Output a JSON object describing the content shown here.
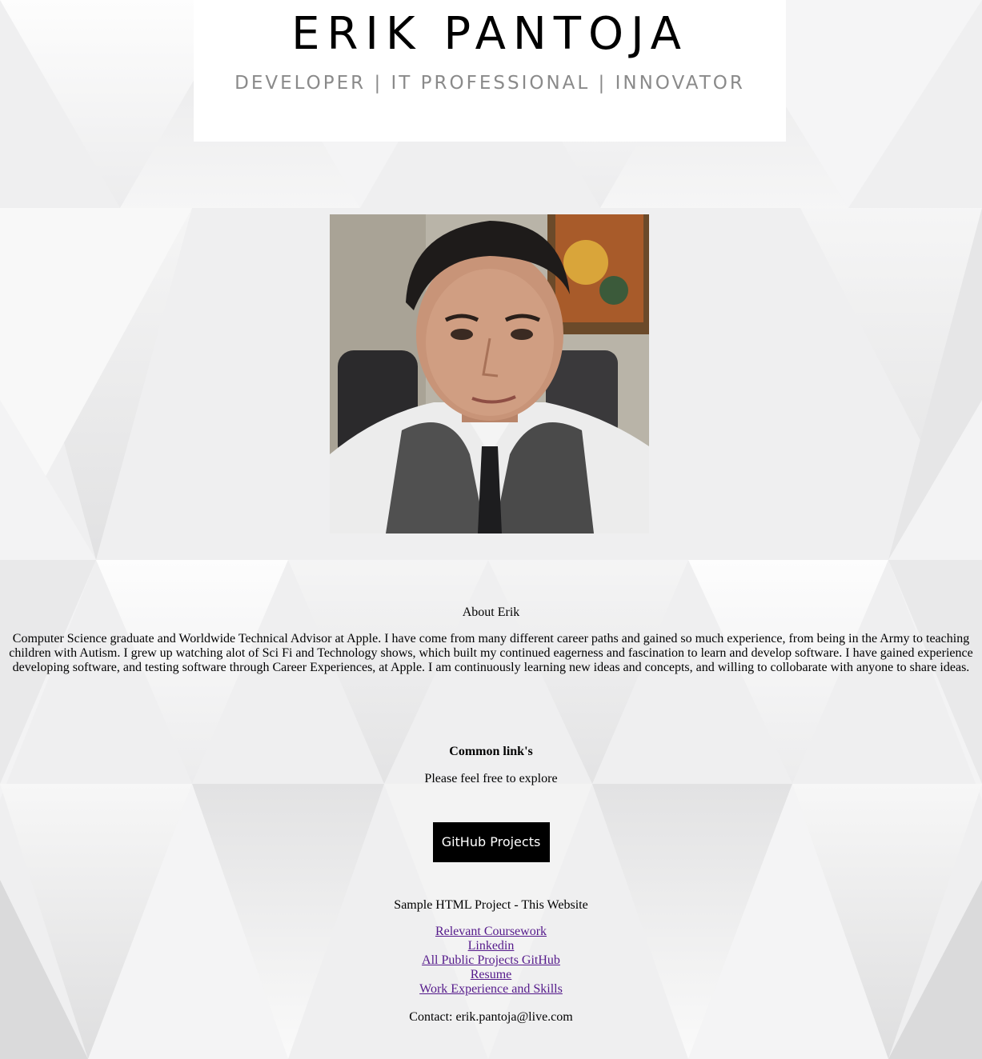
{
  "header": {
    "name": "ERIK PANTOJA",
    "tagline": "DEVELOPER | IT PROFESSIONAL | INNOVATOR"
  },
  "profile_photo": {
    "alt": "Erik Pantoja"
  },
  "about": {
    "title": "About Erik",
    "text": "Computer Science graduate and Worldwide Technical Advisor at Apple. I have come from many different career paths and gained so much experience, from being in the Army to teaching children with Autism. I grew up watching alot of Sci Fi and Technology shows, which built my continued eagerness and fascination to learn and develop software. I have gained experience developing software, and testing software through Career Experiences, at Apple. I am continuously learning new ideas and concepts, and willing to collobarate with anyone to share ideas."
  },
  "links_section": {
    "title": "Common link's",
    "subtitle": "Please feel free to explore",
    "github_button": "GitHub Projects",
    "sample_text": "Sample HTML Project - This Website",
    "links": [
      "Relevant Coursework",
      "Linkedin",
      "All Public Projects GitHub",
      "Resume",
      "Work Experience and Skills"
    ],
    "contact": "Contact: erik.pantoja@live.com"
  },
  "colors": {
    "link": "#551a8b",
    "tagline": "#8a8a8a",
    "button_bg": "#000000",
    "button_text": "#ffffff"
  }
}
